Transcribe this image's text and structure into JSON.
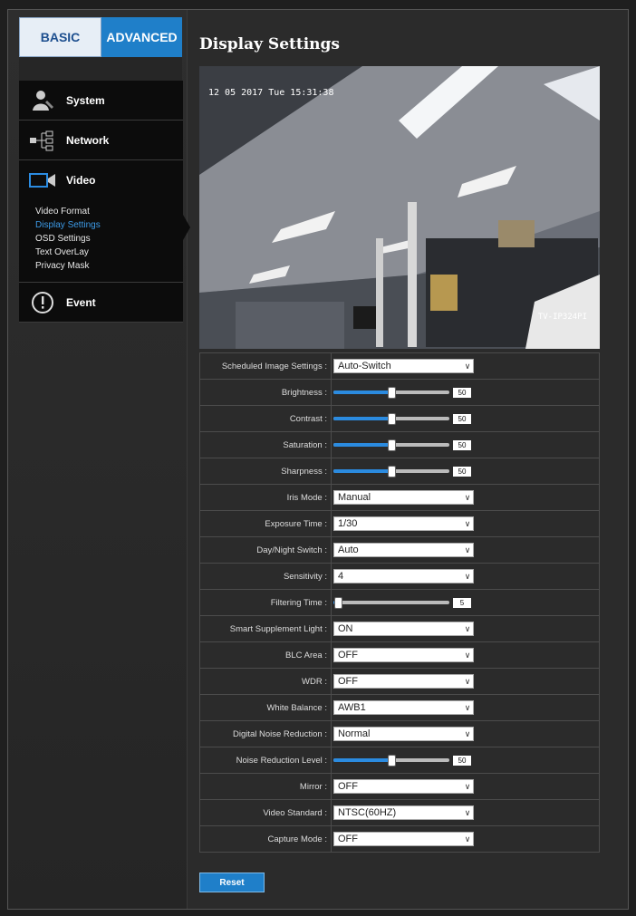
{
  "tabs": {
    "basic": "BASIC",
    "advanced": "ADVANCED"
  },
  "menu": {
    "system": "System",
    "network": "Network",
    "video": "Video",
    "event": "Event",
    "video_sub": [
      "Video Format",
      "Display Settings",
      "OSD Settings",
      "Text OverLay",
      "Privacy Mask"
    ],
    "active_sub": "Display Settings"
  },
  "page_title": "Display Settings",
  "preview": {
    "timestamp": "12 05 2017 Tue 15:31:38",
    "camera_name": "TV-IP324PI"
  },
  "settings": [
    {
      "label": "Scheduled Image Settings :",
      "type": "select",
      "value": "Auto-Switch"
    },
    {
      "label": "Brightness :",
      "type": "slider",
      "value": 50
    },
    {
      "label": "Contrast :",
      "type": "slider",
      "value": 50
    },
    {
      "label": "Saturation :",
      "type": "slider",
      "value": 50
    },
    {
      "label": "Sharpness :",
      "type": "slider",
      "value": 50
    },
    {
      "label": "Iris Mode :",
      "type": "select",
      "value": "Manual"
    },
    {
      "label": "Exposure Time :",
      "type": "select",
      "value": "1/30"
    },
    {
      "label": "Day/Night Switch :",
      "type": "select",
      "value": "Auto"
    },
    {
      "label": "Sensitivity :",
      "type": "select",
      "value": "4"
    },
    {
      "label": "Filtering Time :",
      "type": "slider",
      "value": 5,
      "max": 120
    },
    {
      "label": "Smart Supplement Light :",
      "type": "select",
      "value": "ON"
    },
    {
      "label": "BLC Area :",
      "type": "select",
      "value": "OFF"
    },
    {
      "label": "WDR :",
      "type": "select",
      "value": "OFF"
    },
    {
      "label": "White Balance :",
      "type": "select",
      "value": "AWB1"
    },
    {
      "label": "Digital Noise Reduction :",
      "type": "select",
      "value": "Normal"
    },
    {
      "label": "Noise Reduction Level :",
      "type": "slider",
      "value": 50
    },
    {
      "label": "Mirror :",
      "type": "select",
      "value": "OFF"
    },
    {
      "label": "Video Standard :",
      "type": "select",
      "value": "NTSC(60HZ)"
    },
    {
      "label": "Capture Mode :",
      "type": "select",
      "value": "OFF"
    }
  ],
  "reset_label": "Reset",
  "colors": {
    "accent": "#1f7fc9",
    "active_link": "#3d9be8"
  }
}
